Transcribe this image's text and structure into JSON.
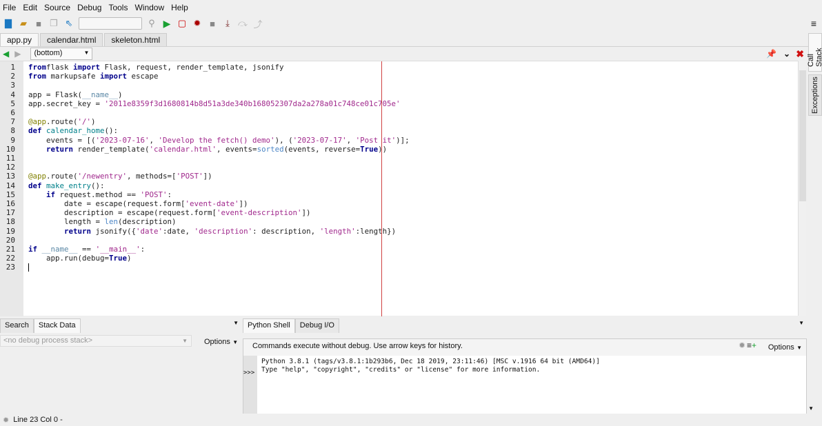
{
  "menu": [
    "File",
    "Edit",
    "Source",
    "Debug",
    "Tools",
    "Window",
    "Help"
  ],
  "file_tabs": [
    "app.py",
    "calendar.html",
    "skeleton.html"
  ],
  "nav": {
    "scope": "(bottom)"
  },
  "side_tabs": [
    "Call Stack",
    "Exceptions"
  ],
  "editor": {
    "lines": [
      [
        [
          "kw",
          "from"
        ],
        [
          "",
          "flask "
        ],
        [
          "kw",
          "import"
        ],
        [
          "",
          " Flask, request, render_template, jsonify"
        ]
      ],
      [
        [
          "kw",
          "from"
        ],
        [
          "",
          " markupsafe "
        ],
        [
          "kw",
          "import"
        ],
        [
          "",
          " escape"
        ]
      ],
      [],
      [
        [
          "",
          "app = Flask("
        ],
        [
          "dn",
          "__name__"
        ],
        [
          "",
          ")"
        ]
      ],
      [
        [
          "",
          "app.secret_key = "
        ],
        [
          "st",
          "'2011e8359f3d1680814b8d51a3de340b168052307da2a278a01c748ce01c705e'"
        ]
      ],
      [],
      [
        [
          "dc",
          "@app"
        ],
        [
          "",
          ".route("
        ],
        [
          "st",
          "'/'"
        ],
        [
          "",
          ")"
        ]
      ],
      [
        [
          "kw",
          "def"
        ],
        [
          "",
          " "
        ],
        [
          "fn",
          "calendar_home"
        ],
        [
          "",
          "():"
        ]
      ],
      [
        [
          "",
          "    events = [("
        ],
        [
          "st",
          "'2023-07-16'"
        ],
        [
          "",
          ", "
        ],
        [
          "st",
          "'Develop the fetch() demo'"
        ],
        [
          "",
          "), ("
        ],
        [
          "st",
          "'2023-07-17'"
        ],
        [
          "",
          ", "
        ],
        [
          "st",
          "'Post it'"
        ],
        [
          "",
          ")];"
        ]
      ],
      [
        [
          "kw",
          "    return"
        ],
        [
          "",
          " render_template("
        ],
        [
          "st",
          "'calendar.html'"
        ],
        [
          "",
          ", events="
        ],
        [
          "bi",
          "sorted"
        ],
        [
          "",
          "(events, reverse="
        ],
        [
          "kw",
          "True"
        ],
        [
          "",
          "))"
        ]
      ],
      [],
      [],
      [
        [
          "dc",
          "@app"
        ],
        [
          "",
          ".route("
        ],
        [
          "st",
          "'/newentry'"
        ],
        [
          "",
          ", methods=["
        ],
        [
          "st",
          "'POST'"
        ],
        [
          "",
          "])"
        ]
      ],
      [
        [
          "kw",
          "def"
        ],
        [
          "",
          " "
        ],
        [
          "fn",
          "make_entry"
        ],
        [
          "",
          "():"
        ]
      ],
      [
        [
          "kw",
          "    if"
        ],
        [
          "",
          " request.method == "
        ],
        [
          "st",
          "'POST'"
        ],
        [
          "",
          ":"
        ]
      ],
      [
        [
          "",
          "        date = escape(request.form["
        ],
        [
          "st",
          "'event-date'"
        ],
        [
          "",
          "])"
        ]
      ],
      [
        [
          "",
          "        description = escape(request.form["
        ],
        [
          "st",
          "'event-description'"
        ],
        [
          "",
          "])"
        ]
      ],
      [
        [
          "",
          "        length = "
        ],
        [
          "bi",
          "len"
        ],
        [
          "",
          "(description)"
        ]
      ],
      [
        [
          "kw",
          "        return"
        ],
        [
          "",
          " jsonify({"
        ],
        [
          "st",
          "'date'"
        ],
        [
          "",
          ":date, "
        ],
        [
          "st",
          "'description'"
        ],
        [
          "",
          ": description, "
        ],
        [
          "st",
          "'length'"
        ],
        [
          "",
          ":length})"
        ]
      ],
      [],
      [
        [
          "kw",
          "if"
        ],
        [
          "",
          " "
        ],
        [
          "dn",
          "__name__"
        ],
        [
          "",
          " == "
        ],
        [
          "st",
          "'__main__'"
        ],
        [
          "",
          ":"
        ]
      ],
      [
        [
          "",
          "    app.run(debug="
        ],
        [
          "kw",
          "True"
        ],
        [
          "",
          ")"
        ]
      ],
      []
    ]
  },
  "left_panel": {
    "tabs": [
      "Search",
      "Stack Data"
    ],
    "stack_placeholder": "<no debug process stack>",
    "options": "Options"
  },
  "right_panel": {
    "tabs": [
      "Python Shell",
      "Debug I/O"
    ],
    "info": "Commands execute without debug.  Use arrow keys for history.",
    "options": "Options",
    "prompt": ">>>",
    "output": [
      "Python 3.8.1 (tags/v3.8.1:1b293b6, Dec 18 2019, 23:11:46) [MSC v.1916 64 bit (AMD64)]",
      "Type \"help\", \"copyright\", \"credits\" or \"license\" for more information."
    ]
  },
  "status": {
    "text": "Line 23 Col 0 -"
  }
}
